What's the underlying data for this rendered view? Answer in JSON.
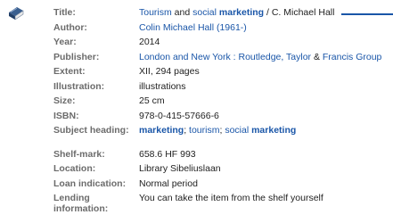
{
  "record": {
    "title": {
      "label": "Title:",
      "part1": "Tourism",
      "and": " and ",
      "part2": "social",
      "space": " ",
      "part3": "marketing",
      "rest": " / C. Michael Hall"
    },
    "author": {
      "label": "Author:",
      "value": "Colin Michael Hall (1961-)"
    },
    "year": {
      "label": "Year:",
      "value": "2014"
    },
    "publisher": {
      "label": "Publisher:",
      "value": "London and New York : Routledge, Taylor",
      "amp": " & ",
      "value2": "Francis Group"
    },
    "extent": {
      "label": "Extent:",
      "value": "XII, 294 pages"
    },
    "illustration": {
      "label": "Illustration:",
      "value": "illustrations"
    },
    "size": {
      "label": "Size:",
      "value": "25 cm"
    },
    "isbn": {
      "label": "ISBN:",
      "value": "978-0-415-57666-6"
    },
    "subject": {
      "label": "Subject heading:",
      "s1": "marketing",
      "sep1": "; ",
      "s2": "tourism",
      "sep2": "; ",
      "s3": "social",
      "space": " ",
      "s4": "marketing"
    }
  },
  "holding": {
    "shelfmark": {
      "label": "Shelf-mark:",
      "value": "658.6 HF 993"
    },
    "location": {
      "label": "Location:",
      "value": "Library Sibeliuslaan"
    },
    "loan": {
      "label": "Loan indication:",
      "value": "Normal period"
    },
    "lending": {
      "label": "Lending information:",
      "value": "You can take the item from the shelf yourself"
    }
  },
  "icons": {
    "book": "book-icon"
  },
  "colors": {
    "link": "#1a56a8",
    "label": "#6b6b6b",
    "text": "#222222"
  }
}
